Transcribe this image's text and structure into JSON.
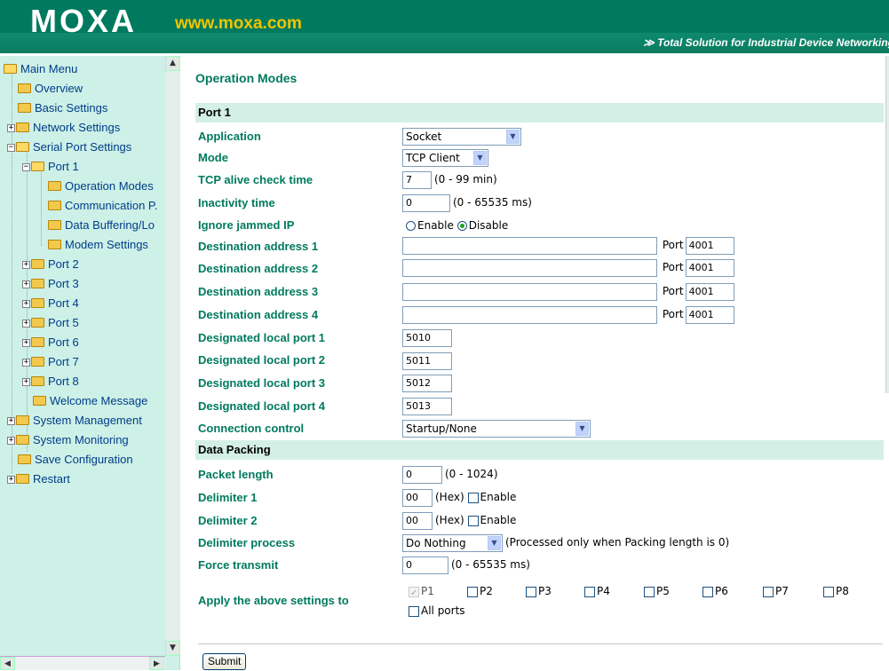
{
  "header": {
    "logo": "MOXA",
    "url": "www.moxa.com",
    "tagline": "≫ Total Solution for Industrial Device Networking"
  },
  "sidebar": {
    "items": [
      {
        "label": "Main Menu",
        "expander": ""
      },
      {
        "label": "Overview",
        "expander": ""
      },
      {
        "label": "Basic Settings",
        "expander": ""
      },
      {
        "label": "Network Settings",
        "expander": "+"
      },
      {
        "label": "Serial Port Settings",
        "expander": "−"
      },
      {
        "label": "Port 1",
        "expander": "−"
      },
      {
        "label": "Operation Modes",
        "expander": ""
      },
      {
        "label": "Communication P.",
        "expander": ""
      },
      {
        "label": "Data Buffering/Lo",
        "expander": ""
      },
      {
        "label": "Modem Settings",
        "expander": ""
      },
      {
        "label": "Port 2",
        "expander": "+"
      },
      {
        "label": "Port 3",
        "expander": "+"
      },
      {
        "label": "Port 4",
        "expander": "+"
      },
      {
        "label": "Port 5",
        "expander": "+"
      },
      {
        "label": "Port 6",
        "expander": "+"
      },
      {
        "label": "Port 7",
        "expander": "+"
      },
      {
        "label": "Port 8",
        "expander": "+"
      },
      {
        "label": "Welcome Message",
        "expander": ""
      },
      {
        "label": "System Management",
        "expander": "+"
      },
      {
        "label": "System Monitoring",
        "expander": "+"
      },
      {
        "label": "Save Configuration",
        "expander": ""
      },
      {
        "label": "Restart",
        "expander": "+"
      }
    ]
  },
  "main": {
    "title": "Operation Modes",
    "section_port": "Port 1",
    "section_packing": "Data Packing",
    "fields": {
      "application": {
        "label": "Application",
        "value": "Socket"
      },
      "mode": {
        "label": "Mode",
        "value": "TCP Client"
      },
      "tcp_alive": {
        "label": "TCP alive check time",
        "value": "7",
        "unit": "(0 - 99 min)"
      },
      "inactivity": {
        "label": "Inactivity time",
        "value": "0",
        "unit": "(0 - 65535 ms)"
      },
      "ignore_ip": {
        "label": "Ignore jammed IP",
        "opt1": "Enable",
        "opt2": "Disable"
      },
      "dest1": {
        "label": "Destination address 1",
        "value": "",
        "port_label": "Port",
        "port": "4001"
      },
      "dest2": {
        "label": "Destination address 2",
        "value": "",
        "port_label": "Port",
        "port": "4001"
      },
      "dest3": {
        "label": "Destination address 3",
        "value": "",
        "port_label": "Port",
        "port": "4001"
      },
      "dest4": {
        "label": "Destination address 4",
        "value": "",
        "port_label": "Port",
        "port": "4001"
      },
      "local1": {
        "label": "Designated local port 1",
        "value": "5010"
      },
      "local2": {
        "label": "Designated local port 2",
        "value": "5011"
      },
      "local3": {
        "label": "Designated local port 3",
        "value": "5012"
      },
      "local4": {
        "label": "Designated local port 4",
        "value": "5013"
      },
      "conn_ctrl": {
        "label": "Connection control",
        "value": "Startup/None"
      },
      "packet_len": {
        "label": "Packet length",
        "value": "0",
        "unit": "(0 - 1024)"
      },
      "delim1": {
        "label": "Delimiter 1",
        "value": "00",
        "unit": "(Hex)",
        "check": "Enable"
      },
      "delim2": {
        "label": "Delimiter 2",
        "value": "00",
        "unit": "(Hex)",
        "check": "Enable"
      },
      "delim_proc": {
        "label": "Delimiter process",
        "value": "Do Nothing",
        "note": "(Processed only when Packing length is 0)"
      },
      "force_tx": {
        "label": "Force transmit",
        "value": "0",
        "unit": "(0 - 65535 ms)"
      },
      "apply": {
        "label": "Apply the above settings to",
        "ports": [
          "P1",
          "P2",
          "P3",
          "P4",
          "P5",
          "P6",
          "P7",
          "P8"
        ],
        "all": "All ports"
      }
    },
    "submit": "Submit"
  }
}
